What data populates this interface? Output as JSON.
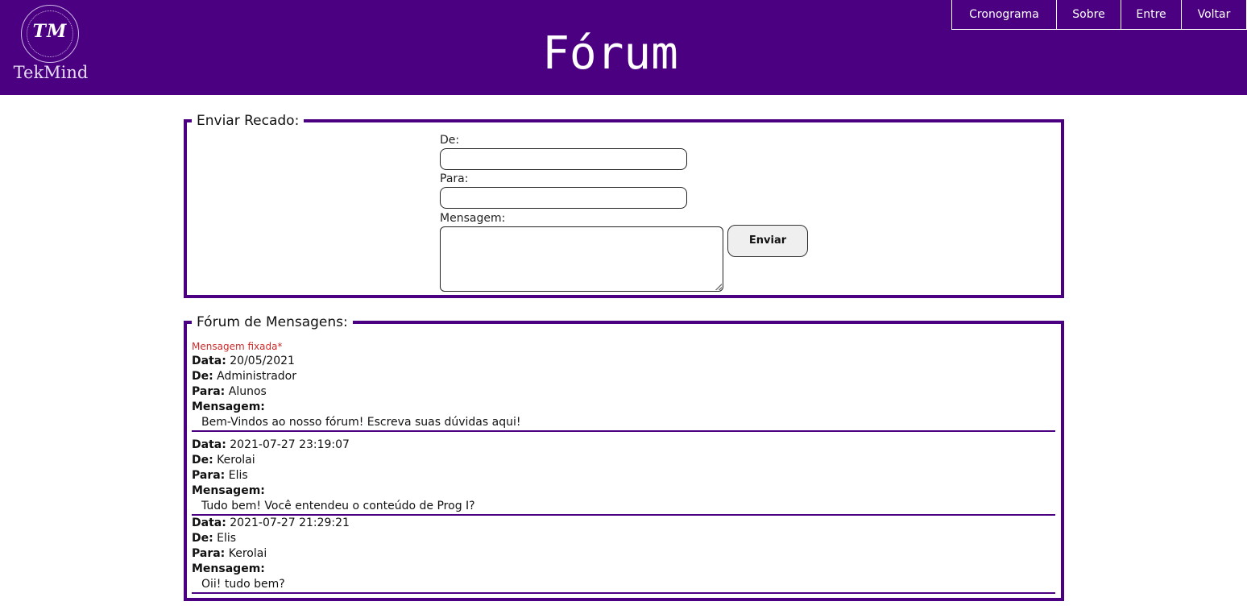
{
  "header": {
    "logo_monogram": "TM",
    "logo_name": "TekMind",
    "title": "Fórum",
    "nav": [
      "Cronograma",
      "Sobre",
      "Entre",
      "Voltar"
    ],
    "background_color": "#4b0082"
  },
  "send_form": {
    "legend": "Enviar Recado:",
    "from_label": "De:",
    "from_value": "",
    "to_label": "Para:",
    "to_value": "",
    "message_label": "Mensagem:",
    "message_value": "",
    "submit_label": "Enviar"
  },
  "forum": {
    "legend": "Fórum de Mensagens:",
    "pinned_label": "Mensagem fixada*",
    "labels": {
      "date": "Data:",
      "from": "De:",
      "to": "Para:",
      "message": "Mensagem:"
    },
    "messages": [
      {
        "date": "20/05/2021",
        "from": "Administrador",
        "to": "Alunos",
        "message": "Bem-Vindos ao nosso fórum! Escreva suas dúvidas aqui!"
      },
      {
        "date": "2021-07-27 23:19:07",
        "from": "Kerolai",
        "to": "Elis",
        "message": "Tudo bem! Você entendeu o conteúdo de Prog I?"
      },
      {
        "date": "2021-07-27 21:29:21",
        "from": "Elis",
        "to": "Kerolai",
        "message": "Oii! tudo bem?"
      }
    ]
  }
}
